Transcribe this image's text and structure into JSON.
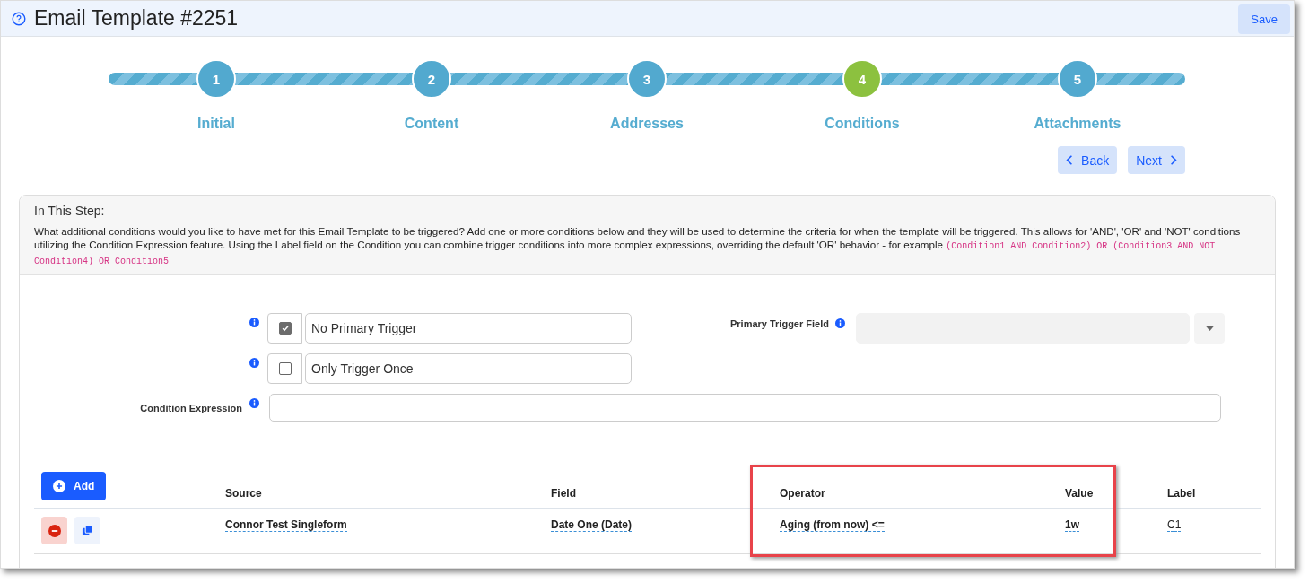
{
  "header": {
    "title": "Email Template #2251",
    "save_label": "Save"
  },
  "steps": [
    {
      "number": "1",
      "label": "Initial",
      "selected": false
    },
    {
      "number": "2",
      "label": "Content",
      "selected": false
    },
    {
      "number": "3",
      "label": "Addresses",
      "selected": false
    },
    {
      "number": "4",
      "label": "Conditions",
      "selected": true
    },
    {
      "number": "5",
      "label": "Attachments",
      "selected": false
    }
  ],
  "nav": {
    "back": "Back",
    "next": "Next"
  },
  "info": {
    "title": "In This Step:",
    "parts": [
      {
        "kind": "text",
        "text": "What additional conditions would you like to have met for this Email Template to be triggered? Add one or more conditions below and they will be used to determine the criteria for when the template will be triggered. This allows for 'AND', 'OR' and 'NOT' conditions utilizing the Condition Expression feature. Using the Label field on the Condition you can combine trigger conditions into more complex expressions, overriding the default 'OR' behavior - for example "
      },
      {
        "kind": "code",
        "text": "(Condition1 AND Condition2) OR (Condition3 AND NOT Condition4) OR Condition5"
      }
    ]
  },
  "options": [
    {
      "label": "No Primary Trigger",
      "checked": true
    },
    {
      "label": "Only Trigger Once",
      "checked": false
    }
  ],
  "primary_trigger_field": {
    "label": "Primary Trigger Field",
    "disabled": true
  },
  "condition_expression": {
    "label": "Condition Expression"
  },
  "table": {
    "add_label": "Add",
    "columns": [
      {
        "label": "Source",
        "highlighted": false
      },
      {
        "label": "Field",
        "highlighted": false
      },
      {
        "label": "Operator",
        "highlighted": true
      },
      {
        "label": "Value",
        "highlighted": true
      },
      {
        "label": "Label",
        "highlighted": false
      }
    ],
    "rows": [
      {
        "source": "Connor Test Singleform",
        "field": "Date One (Date)",
        "operator": "Aging (from now) <=",
        "value": "1w",
        "label": "C1"
      }
    ]
  }
}
